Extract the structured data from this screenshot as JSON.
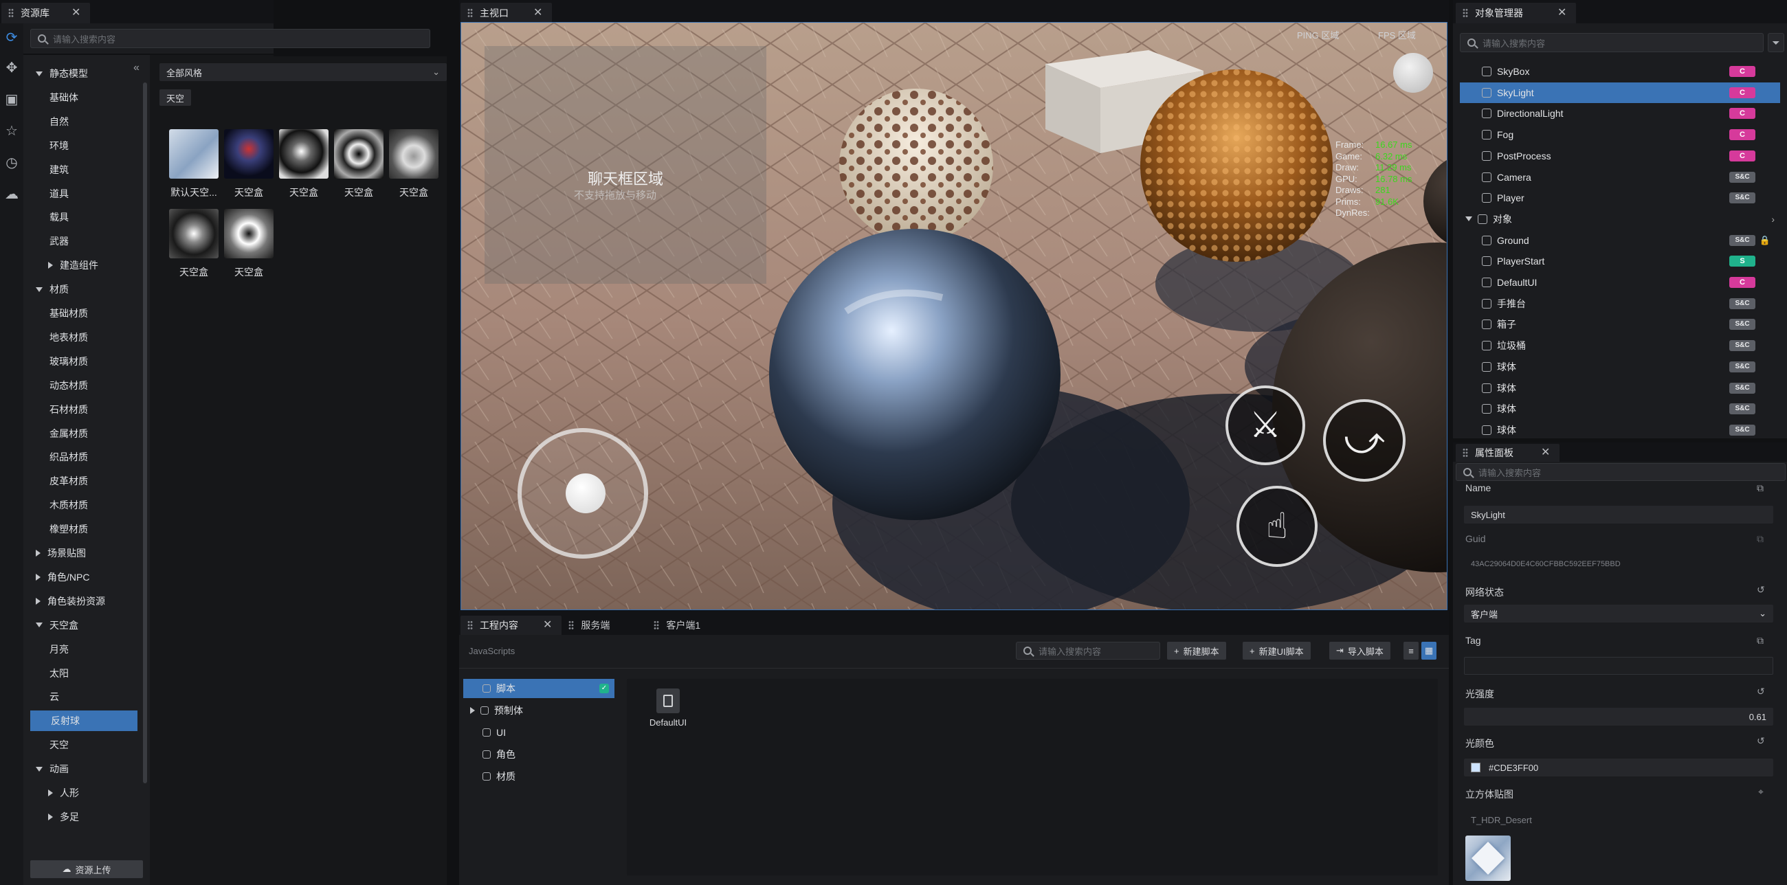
{
  "assets": {
    "tab_title": "资源库",
    "search_placeholder": "请输入搜索内容",
    "filter_value": "全部风格",
    "active_tag": "天空",
    "upload_button": "资源上传",
    "tree": [
      {
        "label": "静态模型",
        "level": 0,
        "expanded": true
      },
      {
        "label": "基础体",
        "level": 1
      },
      {
        "label": "自然",
        "level": 1
      },
      {
        "label": "环境",
        "level": 1
      },
      {
        "label": "建筑",
        "level": 1
      },
      {
        "label": "道具",
        "level": 1
      },
      {
        "label": "载具",
        "level": 1
      },
      {
        "label": "武器",
        "level": 1
      },
      {
        "label": "建造组件",
        "level": 1,
        "collapsed": true
      },
      {
        "label": "材质",
        "level": 0,
        "expanded": true
      },
      {
        "label": "基础材质",
        "level": 1
      },
      {
        "label": "地表材质",
        "level": 1
      },
      {
        "label": "玻璃材质",
        "level": 1
      },
      {
        "label": "动态材质",
        "level": 1
      },
      {
        "label": "石材材质",
        "level": 1
      },
      {
        "label": "金属材质",
        "level": 1
      },
      {
        "label": "织品材质",
        "level": 1
      },
      {
        "label": "皮革材质",
        "level": 1
      },
      {
        "label": "木质材质",
        "level": 1
      },
      {
        "label": "橡塑材质",
        "level": 1
      },
      {
        "label": "场景贴图",
        "level": 0,
        "collapsed": true
      },
      {
        "label": "角色/NPC",
        "level": 0,
        "collapsed": true
      },
      {
        "label": "角色装扮资源",
        "level": 0,
        "collapsed": true
      },
      {
        "label": "天空盒",
        "level": 0,
        "expanded": true
      },
      {
        "label": "月亮",
        "level": 1
      },
      {
        "label": "太阳",
        "level": 1
      },
      {
        "label": "云",
        "level": 1
      },
      {
        "label": "反射球",
        "level": 1,
        "selected": true
      },
      {
        "label": "天空",
        "level": 1
      },
      {
        "label": "动画",
        "level": 0,
        "expanded": true
      },
      {
        "label": "人形",
        "level": 1,
        "collapsed": true
      },
      {
        "label": "多足",
        "level": 1,
        "collapsed": true
      }
    ],
    "items": [
      {
        "label": "默认天空..."
      },
      {
        "label": "天空盒"
      },
      {
        "label": "天空盒"
      },
      {
        "label": "天空盒"
      },
      {
        "label": "天空盒"
      },
      {
        "label": "天空盒"
      },
      {
        "label": "天空盒"
      }
    ]
  },
  "viewport": {
    "tab_title": "主视口",
    "ping_label": "PING 区域",
    "fps_label": "FPS 区域",
    "chat_title": "聊天框区域",
    "chat_sub": "不支持拖放与移动",
    "stats": [
      {
        "k": "Frame:",
        "v": "16.67 ms"
      },
      {
        "k": "Game:",
        "v": "6.32 ms"
      },
      {
        "k": "Draw:",
        "v": "11.29 ms"
      },
      {
        "k": "GPU:",
        "v": "16.78 ms"
      },
      {
        "k": "Draws:",
        "v": "281"
      },
      {
        "k": "Prims:",
        "v": "91.6K"
      },
      {
        "k": "DynRes:",
        "v": ""
      }
    ]
  },
  "objects": {
    "tab_title": "对象管理器",
    "search_placeholder": "请输入搜索内容",
    "rows": [
      {
        "label": "SkyBox",
        "badge": "C",
        "indent": 1
      },
      {
        "label": "SkyLight",
        "badge": "C",
        "indent": 1,
        "selected": true
      },
      {
        "label": "DirectionalLight",
        "badge": "C",
        "indent": 1
      },
      {
        "label": "Fog",
        "badge": "C",
        "indent": 1
      },
      {
        "label": "PostProcess",
        "badge": "C",
        "indent": 1
      },
      {
        "label": "Camera",
        "badge": "S&C",
        "indent": 1
      },
      {
        "label": "Player",
        "badge": "S&C",
        "indent": 1
      },
      {
        "label": "对象",
        "badge": "",
        "indent": 0,
        "group": true
      },
      {
        "label": "Ground",
        "badge": "S&C",
        "indent": 1,
        "lock": true
      },
      {
        "label": "PlayerStart",
        "badge": "S",
        "indent": 1
      },
      {
        "label": "DefaultUI",
        "badge": "C",
        "indent": 1
      },
      {
        "label": "手推台",
        "badge": "S&C",
        "indent": 1
      },
      {
        "label": "箱子",
        "badge": "S&C",
        "indent": 1
      },
      {
        "label": "垃圾桶",
        "badge": "S&C",
        "indent": 1
      },
      {
        "label": "球体",
        "badge": "S&C",
        "indent": 1
      },
      {
        "label": "球体",
        "badge": "S&C",
        "indent": 1
      },
      {
        "label": "球体",
        "badge": "S&C",
        "indent": 1
      },
      {
        "label": "球体",
        "badge": "S&C",
        "indent": 1
      }
    ]
  },
  "properties": {
    "tab_title": "属性面板",
    "search_placeholder": "请输入搜索内容",
    "name_label": "Name",
    "name_value": "SkyLight",
    "guid_label": "Guid",
    "guid_value": "43AC29064D0E4C60CFBBC592EEF75BBD",
    "net_label": "网络状态",
    "net_value": "客户端",
    "tag_label": "Tag",
    "tag_value": "",
    "intensity_label": "光强度",
    "intensity_value": "0.61",
    "color_label": "光颜色",
    "color_value": "#CDE3FF00",
    "cubemap_label": "立方体贴图",
    "cubemap_value": "T_HDR_Desert"
  },
  "project": {
    "tabs": [
      "工程内容",
      "服务端",
      "客户端1"
    ],
    "breadcrumb": "JavaScripts",
    "search_placeholder": "请输入搜索内容",
    "btn_new_script": "新建脚本",
    "btn_new_ui_script": "新建UI脚本",
    "btn_import": "导入脚本",
    "folders": [
      {
        "label": "脚本",
        "selected": true
      },
      {
        "label": "预制体",
        "collapsed": true
      },
      {
        "label": "UI"
      },
      {
        "label": "角色"
      },
      {
        "label": "材质"
      }
    ],
    "files": [
      {
        "label": "DefaultUI"
      }
    ]
  },
  "colors": {
    "accent": "#3a73b5",
    "badge_c": "#d63a9b",
    "badge_s": "#20b28c",
    "badge_sc": "#5c5f66",
    "stats_value": "#3bd81d"
  }
}
